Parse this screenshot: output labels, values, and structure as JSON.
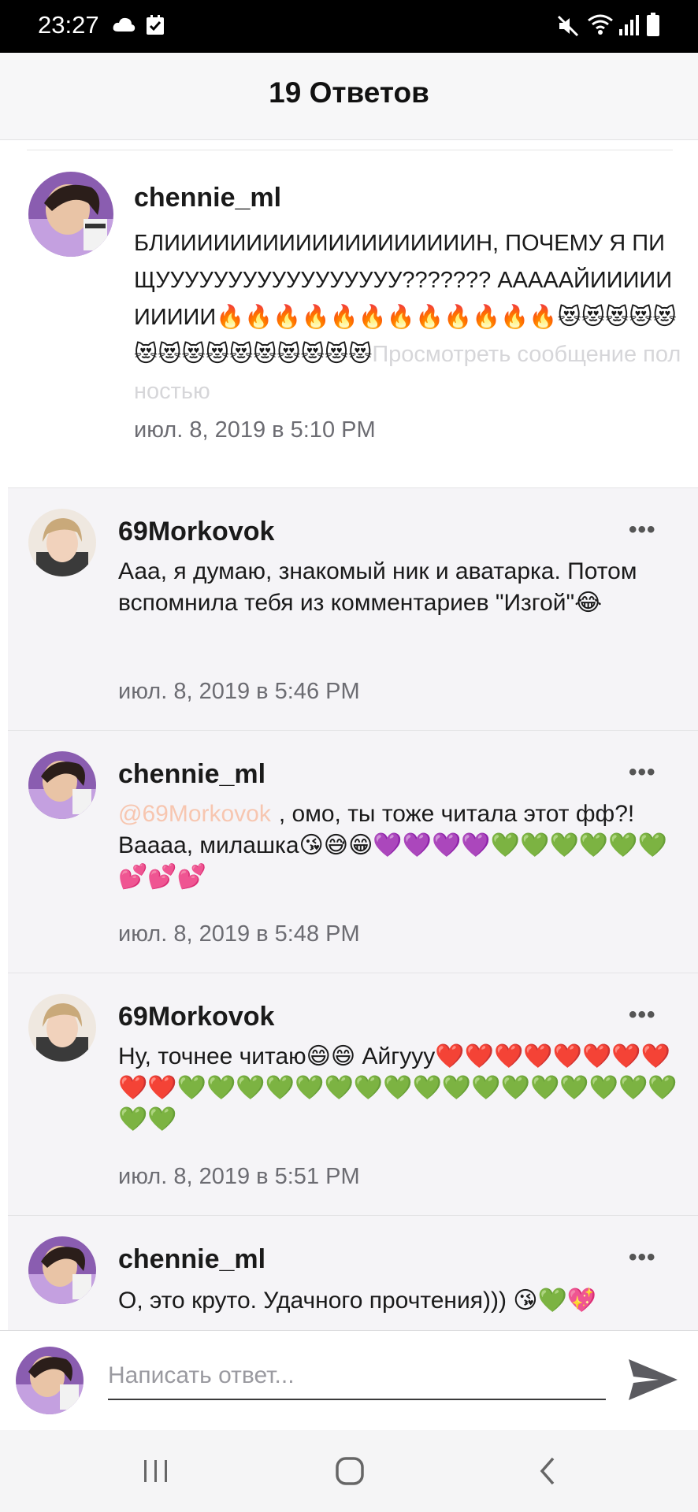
{
  "status_bar": {
    "time": "23:27",
    "icons": [
      "cloud-icon",
      "check-box-icon",
      "mute-icon",
      "wifi-icon",
      "signal-icon",
      "battery-icon"
    ]
  },
  "header": {
    "title": "19 Ответов"
  },
  "parent_comment": {
    "author": "chennie_ml",
    "text": "БЛИИИИИИИИИИИИИИИИИИИН, ПОЧЕМУ Я ПИЩУУУУУУУУУУУУУУУУУ??????? АААААЙИИИИИИИИИИ🔥🔥🔥🔥🔥🔥🔥🔥🔥🔥🔥🔥😻😻😻😻😻😻😻😻😻😻😻😻😻😻😻",
    "more_link": "Просмотреть сообщение полностью",
    "date": "июл. 8, 2019 в 5:10 PM"
  },
  "replies": [
    {
      "author": "69Morkovok",
      "text": "Ааа, я думаю, знакомый ник и аватарка. Потом вспомнила тебя из комментариев \"Изгой\"😂",
      "date": "июл. 8, 2019 в 5:46 PM",
      "menu": "•••"
    },
    {
      "author": "chennie_ml",
      "mention": "@69Morkovok",
      "text": ", омо, ты тоже читала этот фф?! Ваааа, милашка😘😅😁💜💜💜💜💚💚💚💚💚💚💕💕💕",
      "date": "июл. 8, 2019 в 5:48 PM",
      "menu": "•••"
    },
    {
      "author": "69Morkovok",
      "text": "Ну, точнее читаю😄😄 Айгууу❤️❤️❤️❤️❤️❤️❤️❤️❤️❤️💚💚💚💚💚💚💚💚💚💚💚💚💚💚💚💚💚💚💚",
      "date": "июл. 8, 2019 в 5:51 PM",
      "menu": "•••"
    },
    {
      "author": "chennie_ml",
      "text": "О, это круто. Удачного прочтения))) 😘💚💖",
      "menu": "•••"
    }
  ],
  "composer": {
    "placeholder": "Написать ответ..."
  },
  "nav": {
    "icons": [
      "recent-apps-icon",
      "home-icon",
      "back-icon"
    ]
  },
  "colors": {
    "mention": "#f7c6b0",
    "more_link": "#d6d6d9",
    "reply_bg": "#f5f4f7"
  }
}
